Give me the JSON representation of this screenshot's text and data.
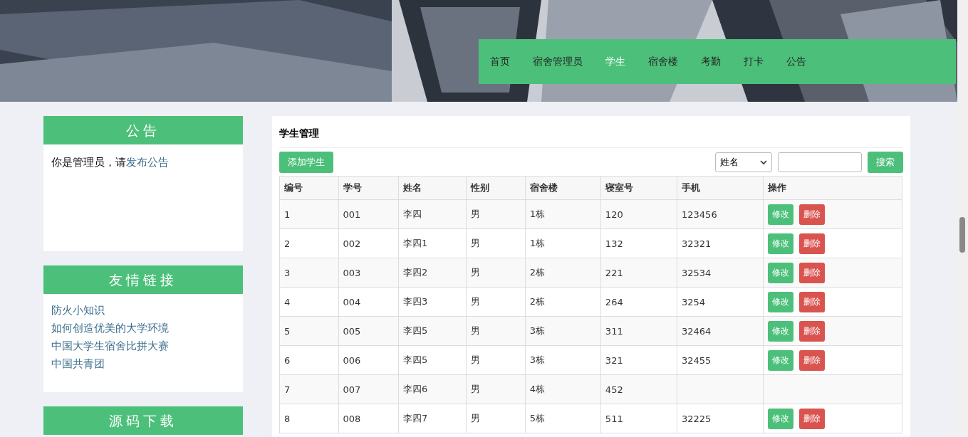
{
  "nav": [
    {
      "label": "首页",
      "selected": false
    },
    {
      "label": "宿舍管理员",
      "selected": false
    },
    {
      "label": "学生",
      "selected": true
    },
    {
      "label": "宿舍楼",
      "selected": false
    },
    {
      "label": "考勤",
      "selected": false
    },
    {
      "label": "打卡",
      "selected": false
    },
    {
      "label": "公告",
      "selected": false
    }
  ],
  "sidebar": [
    {
      "title": "公告",
      "kind": "notice",
      "text": "你是管理员，请",
      "link": "发布公告"
    },
    {
      "title": "友情链接",
      "kind": "links",
      "links": [
        "防火小知识",
        "如何创造优美的大学环境",
        "中国大学生宿舍比拼大赛",
        "中国共青团"
      ]
    },
    {
      "title": "源码下载",
      "kind": "notice"
    }
  ],
  "panel": {
    "title": "学生管理",
    "add_button": "添加学生",
    "filter": "姓名",
    "search_button": "搜索",
    "columns": [
      "编号",
      "学号",
      "姓名",
      "性别",
      "宿舍楼",
      "寝室号",
      "手机",
      "操作"
    ],
    "rows": [
      {
        "cells": [
          "1",
          "001",
          "李四",
          "男",
          "1栋",
          "120",
          "123456"
        ],
        "actions": [
          "修改",
          "删除"
        ]
      },
      {
        "cells": [
          "2",
          "002",
          "李四1",
          "男",
          "1栋",
          "132",
          "32321"
        ],
        "actions": [
          "修改",
          "删除"
        ]
      },
      {
        "cells": [
          "3",
          "003",
          "李四2",
          "男",
          "2栋",
          "221",
          "32534"
        ],
        "actions": [
          "修改",
          "删除"
        ]
      },
      {
        "cells": [
          "4",
          "004",
          "李四3",
          "男",
          "2栋",
          "264",
          "3254"
        ],
        "actions": [
          "修改",
          "删除"
        ]
      },
      {
        "cells": [
          "5",
          "005",
          "李四5",
          "男",
          "3栋",
          "311",
          "32464"
        ],
        "actions": [
          "修改",
          "删除"
        ]
      },
      {
        "cells": [
          "6",
          "006",
          "李四5",
          "男",
          "3栋",
          "321",
          "32455"
        ],
        "actions": [
          "修改",
          "删除"
        ]
      },
      {
        "cells": [
          "7",
          "007",
          "李四6",
          "男",
          "4栋",
          "452"
        ]
      },
      {
        "cells": [
          "8",
          "008",
          "李四7",
          "男",
          "5栋",
          "511",
          "32225"
        ],
        "actions": [
          "修改",
          "删除"
        ]
      }
    ]
  }
}
